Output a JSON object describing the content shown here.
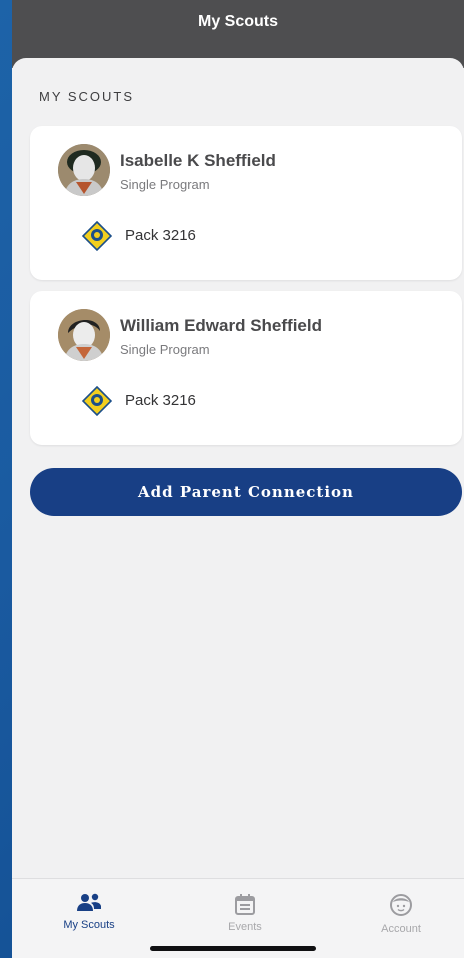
{
  "header": {
    "title": "My Scouts"
  },
  "section": {
    "title": "MY SCOUTS"
  },
  "scouts": [
    {
      "name": "Isabelle K Sheffield",
      "program": "Single Program",
      "unit": "Pack 3216"
    },
    {
      "name": "William Edward Sheffield",
      "program": "Single Program",
      "unit": "Pack 3216"
    }
  ],
  "actions": {
    "add_parent_connection": "Add Parent Connection"
  },
  "tabbar": {
    "items": [
      {
        "label": "My Scouts",
        "icon": "people-icon",
        "active": true
      },
      {
        "label": "Events",
        "icon": "calendar-icon",
        "active": false
      },
      {
        "label": "Account",
        "icon": "face-icon",
        "active": false
      }
    ]
  },
  "colors": {
    "accent": "#183f85",
    "header_bg": "#4e4e50",
    "background": "#1a5aa0",
    "inactive": "#a8a8ab"
  }
}
